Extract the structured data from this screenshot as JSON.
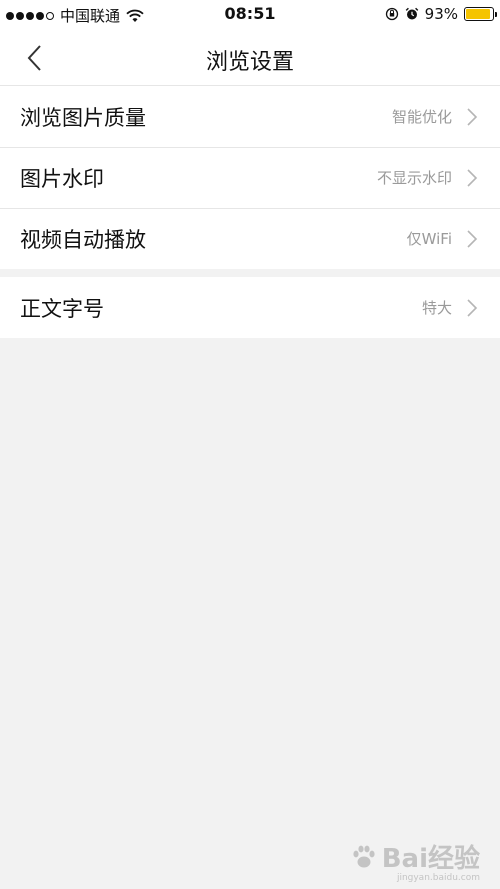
{
  "status_bar": {
    "carrier": "中国联通",
    "time": "08:51",
    "battery_percent": "93%",
    "battery_level": 0.93,
    "battery_color": "#f5c400"
  },
  "nav": {
    "title": "浏览设置",
    "back_icon": "chevron-left-icon"
  },
  "groups": [
    {
      "items": [
        {
          "label": "浏览图片质量",
          "value": "智能优化"
        },
        {
          "label": "图片水印",
          "value": "不显示水印"
        },
        {
          "label": "视频自动播放",
          "value": "仅WiFi"
        }
      ]
    },
    {
      "items": [
        {
          "label": "正文字号",
          "value": "特大"
        }
      ]
    }
  ],
  "watermark": {
    "logo_text": "Bai经验",
    "sub_text": "jingyan.baidu.com"
  },
  "colors": {
    "background": "#f2f2f2",
    "secondary_text": "#9a9a9a",
    "divider": "#e6e6e6"
  }
}
